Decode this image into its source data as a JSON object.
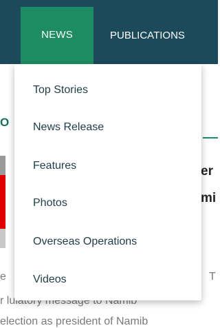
{
  "nav": {
    "tabs": [
      {
        "label": "NEWS",
        "active": true
      },
      {
        "label": "PUBLICATIONS",
        "active": false
      }
    ]
  },
  "dropdown": {
    "items": [
      {
        "label": "Top Stories"
      },
      {
        "label": "News Release"
      },
      {
        "label": "Features"
      },
      {
        "label": "Photos"
      },
      {
        "label": "Overseas Operations"
      },
      {
        "label": "Videos"
      }
    ]
  },
  "background": {
    "section_letter": "O",
    "headline_fragment_1": "er",
    "headline_fragment_2": "mi",
    "text_fragment_left": "e",
    "text_fragment_right": "T",
    "text_line_2": "r lulatory message to Namib",
    "text_line_3": "election as president of Namib"
  },
  "colors": {
    "navbar": "#1c4a5a",
    "active_tab": "#1e8c63",
    "menu_text": "#1f3d47"
  }
}
